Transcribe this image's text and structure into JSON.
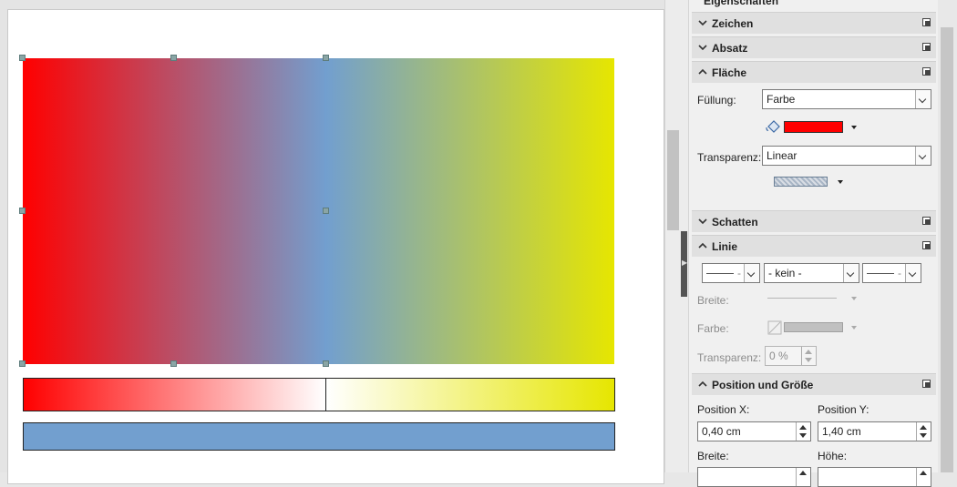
{
  "colors": {
    "gradient_start": "#ff0000",
    "gradient_mid": "#729fcf",
    "gradient_end": "#e6e600",
    "fill_color_swatch": "#ff0000",
    "blue_bar": "#729fcf"
  },
  "sidebar": {
    "deck_title": "Eigenschaften",
    "sections": {
      "zeichen": {
        "title": "Zeichen",
        "expanded": false,
        "icon": "chevron-down-icon"
      },
      "absatz": {
        "title": "Absatz",
        "expanded": false,
        "icon": "chevron-down-icon"
      },
      "flaeche": {
        "title": "Fläche",
        "expanded": true,
        "icon": "chevron-up-icon",
        "fill_label": "Füllung:",
        "fill_value": "Farbe",
        "transparency_label": "Transparenz:",
        "transparency_value": "Linear"
      },
      "schatten": {
        "title": "Schatten",
        "expanded": false,
        "icon": "chevron-down-icon"
      },
      "linie": {
        "title": "Linie",
        "expanded": true,
        "icon": "chevron-up-icon",
        "arrow_start_value": "-",
        "style_value": "- kein -",
        "arrow_end_value": "-",
        "width_label": "Breite:",
        "color_label": "Farbe:",
        "transparency_label": "Transparenz:",
        "transparency_value": "0 %"
      },
      "position": {
        "title": "Position und Größe",
        "expanded": true,
        "icon": "chevron-up-icon",
        "pos_x_label": "Position X:",
        "pos_x_value": "0,40 cm",
        "pos_y_label": "Position Y:",
        "pos_y_value": "1,40 cm",
        "width_label": "Breite:",
        "height_label": "Höhe:"
      }
    }
  }
}
